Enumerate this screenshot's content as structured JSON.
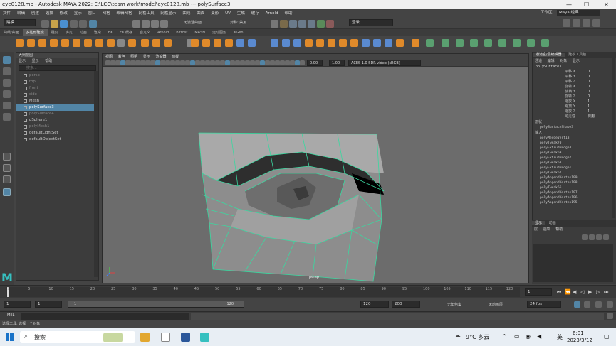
{
  "title": "eye0128.mb - Autodesk MAYA 2022: E:\\LCC\\team work\\model\\eye0128.mb   ---   polySurface3",
  "window_controls": [
    "—",
    "☐",
    "✕"
  ],
  "menubar": [
    "文件",
    "编辑",
    "创建",
    "选择",
    "修改",
    "显示",
    "窗口",
    "网格",
    "编辑网格",
    "网格工具",
    "网格显示",
    "曲线",
    "曲面",
    "变形",
    "UV",
    "生成",
    "缓存",
    "Arnold",
    "帮助"
  ],
  "workspace": {
    "label": "工作区:",
    "value": "Maya 经典"
  },
  "status": {
    "mode": "建模",
    "no_live": "无激活曲面",
    "symmetry": "对称: 禁用",
    "login": "登录"
  },
  "shelf_tabs": [
    "曲线/曲面",
    "多边形建模",
    "雕刻",
    "绑定",
    "动画",
    "渲染",
    "FX",
    "FX 缓存",
    "自定义",
    "Arnold",
    "Bifrost",
    "MASH",
    "运动图形",
    "XGen"
  ],
  "shelf_active": 1,
  "outliner": {
    "title": "大纲视图",
    "menu": [
      "显示",
      "显示",
      "帮助"
    ],
    "search_placeholder": "搜索...",
    "items": [
      {
        "label": "persp",
        "dim": true,
        "sel": false
      },
      {
        "label": "top",
        "dim": true,
        "sel": false
      },
      {
        "label": "front",
        "dim": true,
        "sel": false
      },
      {
        "label": "side",
        "dim": true,
        "sel": false
      },
      {
        "label": "Mesh",
        "dim": false,
        "sel": false
      },
      {
        "label": "polySurface3",
        "dim": false,
        "sel": true
      },
      {
        "label": "polySurface4",
        "dim": true,
        "sel": false
      },
      {
        "label": "pSphere1",
        "dim": false,
        "sel": false
      },
      {
        "label": "polyMesh1",
        "dim": true,
        "sel": false
      },
      {
        "label": "defaultLightSet",
        "dim": false,
        "sel": false
      },
      {
        "label": "defaultObjectSet",
        "dim": false,
        "sel": false
      }
    ]
  },
  "viewport": {
    "menu": [
      "视图",
      "着色",
      "照明",
      "显示",
      "渲染器",
      "面板"
    ],
    "gamma_a": "0.00",
    "gamma_b": "1.00",
    "color_space": "ACES 1.0 SDR-video (sRGB)",
    "camera_label": "persp"
  },
  "channel_box": {
    "tabs": [
      "通道盒/层编辑器",
      "建模工具包"
    ],
    "menu": [
      "通道",
      "编辑",
      "对象",
      "显示"
    ],
    "object": "polySurface3",
    "attrs": [
      {
        "k": "平移 X",
        "v": "0"
      },
      {
        "k": "平移 Y",
        "v": "0"
      },
      {
        "k": "平移 Z",
        "v": "0"
      },
      {
        "k": "旋转 X",
        "v": "0"
      },
      {
        "k": "旋转 Y",
        "v": "0"
      },
      {
        "k": "旋转 Z",
        "v": "0"
      },
      {
        "k": "缩放 X",
        "v": "1"
      },
      {
        "k": "缩放 Y",
        "v": "1"
      },
      {
        "k": "缩放 Z",
        "v": "1"
      },
      {
        "k": "可见性",
        "v": "启用"
      }
    ],
    "shape_header": "形状",
    "shape": "polySurfaceShape3",
    "inputs_header": "输入",
    "inputs": [
      "polyMergeVert13",
      "polyTweak70",
      "polyExtrudeEdge3",
      "polyTweak69",
      "polyExtrudeEdge2",
      "polyTweak68",
      "polyExtrudeEdge1",
      "polyTweak67",
      "polyAppendVertex199",
      "polyAppendVertex198",
      "polyTweak66",
      "polyAppendVertex197",
      "polyAppendVertex196",
      "polyAppendVertex195"
    ]
  },
  "layers": {
    "tabs": [
      "显示",
      "动画"
    ],
    "menu": [
      "层",
      "选项",
      "帮助"
    ]
  },
  "timeline": {
    "ticks": [
      "1",
      "5",
      "10",
      "15",
      "20",
      "25",
      "30",
      "35",
      "40",
      "45",
      "50",
      "55",
      "60",
      "65",
      "70",
      "75",
      "80",
      "85",
      "90",
      "95",
      "100",
      "105",
      "110",
      "115",
      "120"
    ],
    "current": "1"
  },
  "range": {
    "start": "1",
    "start2": "1",
    "slider_start": "1",
    "slider_end": "120",
    "end": "120",
    "end2": "200",
    "char_set": "无角色集",
    "anim_layer": "无动画层",
    "fps": "24 fps"
  },
  "mel_label": "MEL",
  "help_line": "选择工具: 选择一个对象",
  "taskbar": {
    "search": "搜索",
    "weather": "9°C 多云",
    "lang": "英",
    "time": "6:01",
    "date": "2023/3/12"
  },
  "colors": {
    "accent": "#5285a6",
    "wire": "#3ad8a0",
    "mesh": "#8a8a8a"
  }
}
